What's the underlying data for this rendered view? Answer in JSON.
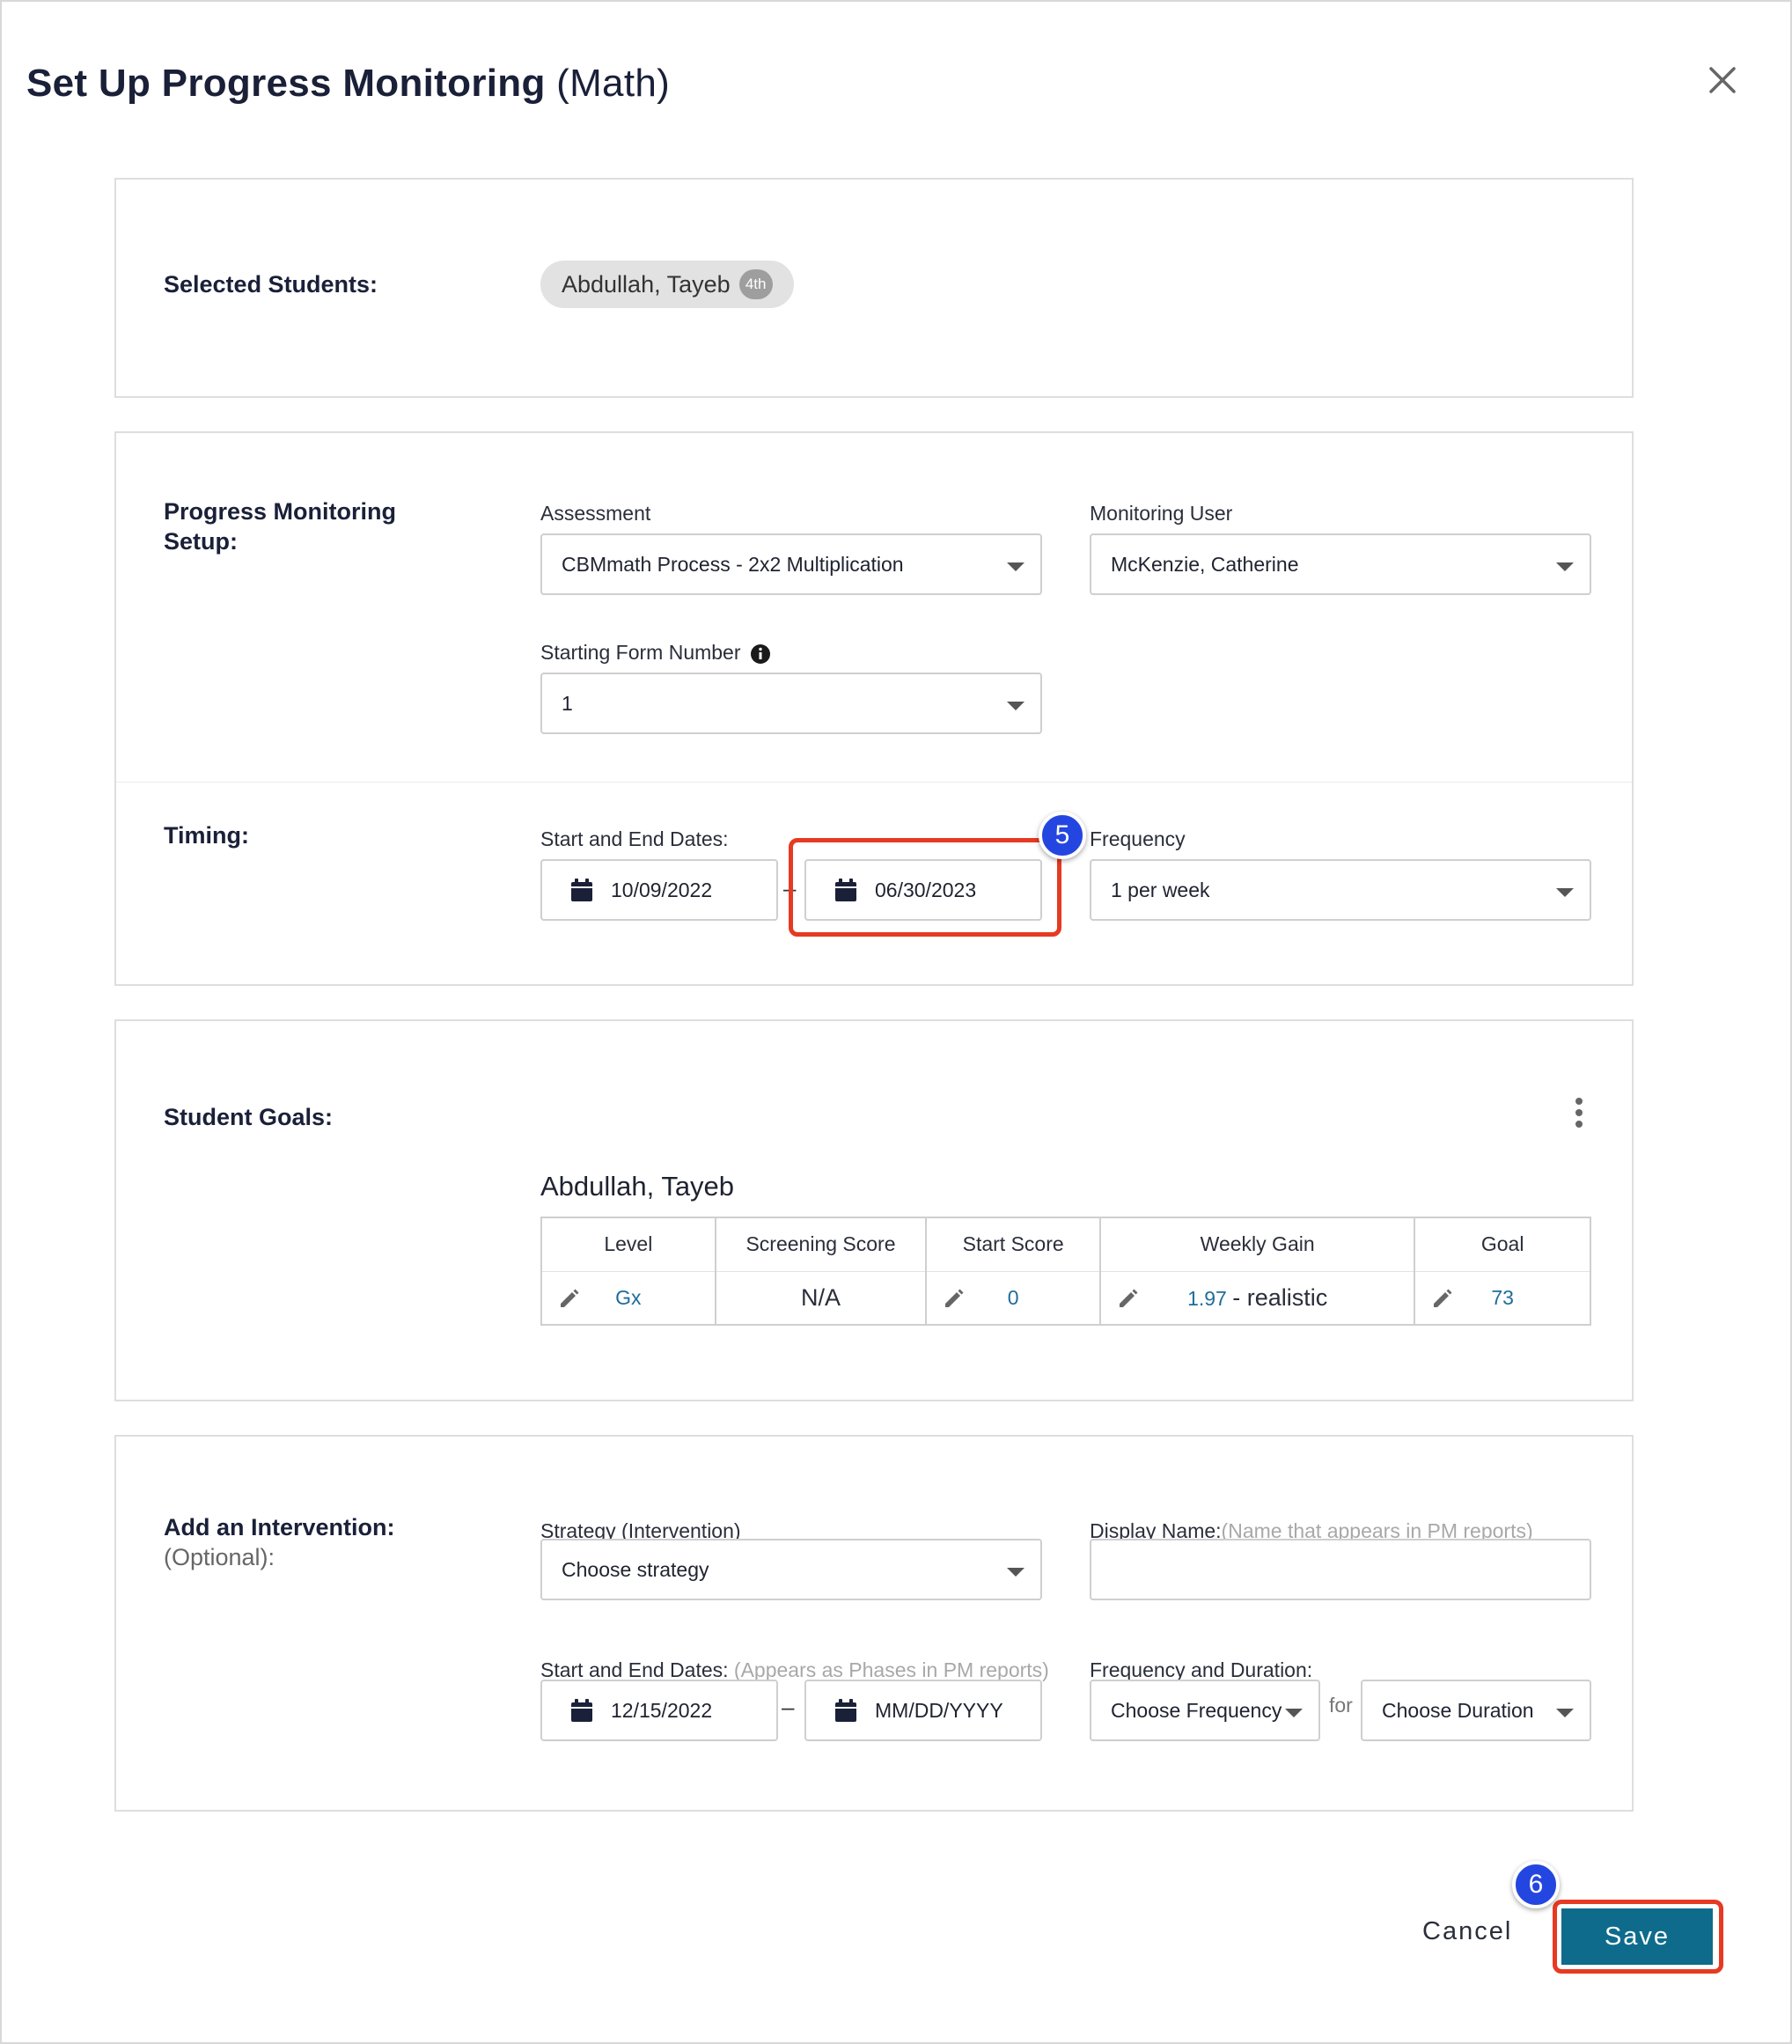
{
  "dialog": {
    "title": "Set Up Progress Monitoring",
    "subject": "(Math)"
  },
  "selected_students": {
    "label": "Selected Students:",
    "chip_name": "Abdullah, Tayeb",
    "chip_grade": "4th"
  },
  "pm_setup": {
    "label": "Progress Monitoring Setup:",
    "assessment_label": "Assessment",
    "assessment_value": "CBMmath Process - 2x2 Multiplication",
    "monitoring_user_label": "Monitoring User",
    "monitoring_user_value": "McKenzie, Catherine",
    "starting_form_label": "Starting Form Number",
    "starting_form_value": "1"
  },
  "timing": {
    "label": "Timing:",
    "dates_label": "Start and End Dates:",
    "start_date": "10/09/2022",
    "end_date": "06/30/2023",
    "frequency_label": "Frequency",
    "frequency_value": "1 per week"
  },
  "goals": {
    "label": "Student Goals:",
    "student_name": "Abdullah, Tayeb",
    "columns": [
      "Level",
      "Screening Score",
      "Start Score",
      "Weekly Gain",
      "Goal"
    ],
    "level": "Gx",
    "screening_score": "N/A",
    "start_score": "0",
    "weekly_gain": "1.97",
    "weekly_gain_desc": "- realistic",
    "goal": "73"
  },
  "intervention": {
    "label": "Add an Intervention:",
    "optional": "(Optional):",
    "strategy_label": "Strategy (Intervention)",
    "strategy_value": "Choose strategy",
    "display_name_label": "Display Name:",
    "display_name_hint": "(Name that appears in PM reports)",
    "display_name_value": "",
    "dates_label": "Start and End Dates:",
    "dates_hint": "(Appears as Phases in PM reports)",
    "start_date": "12/15/2022",
    "end_date_placeholder": "MM/DD/YYYY",
    "freq_dur_label": "Frequency and Duration:",
    "frequency_value": "Choose Frequency",
    "for_text": "for",
    "duration_value": "Choose Duration"
  },
  "annotations": {
    "step5": "5",
    "step6": "6"
  },
  "footer": {
    "cancel_label": "Cancel",
    "save_label": "Save"
  },
  "colors": {
    "accent": "#0e6b8c",
    "highlight": "#e63a22",
    "step_badge": "#2446e0",
    "link": "#1f6d99"
  }
}
